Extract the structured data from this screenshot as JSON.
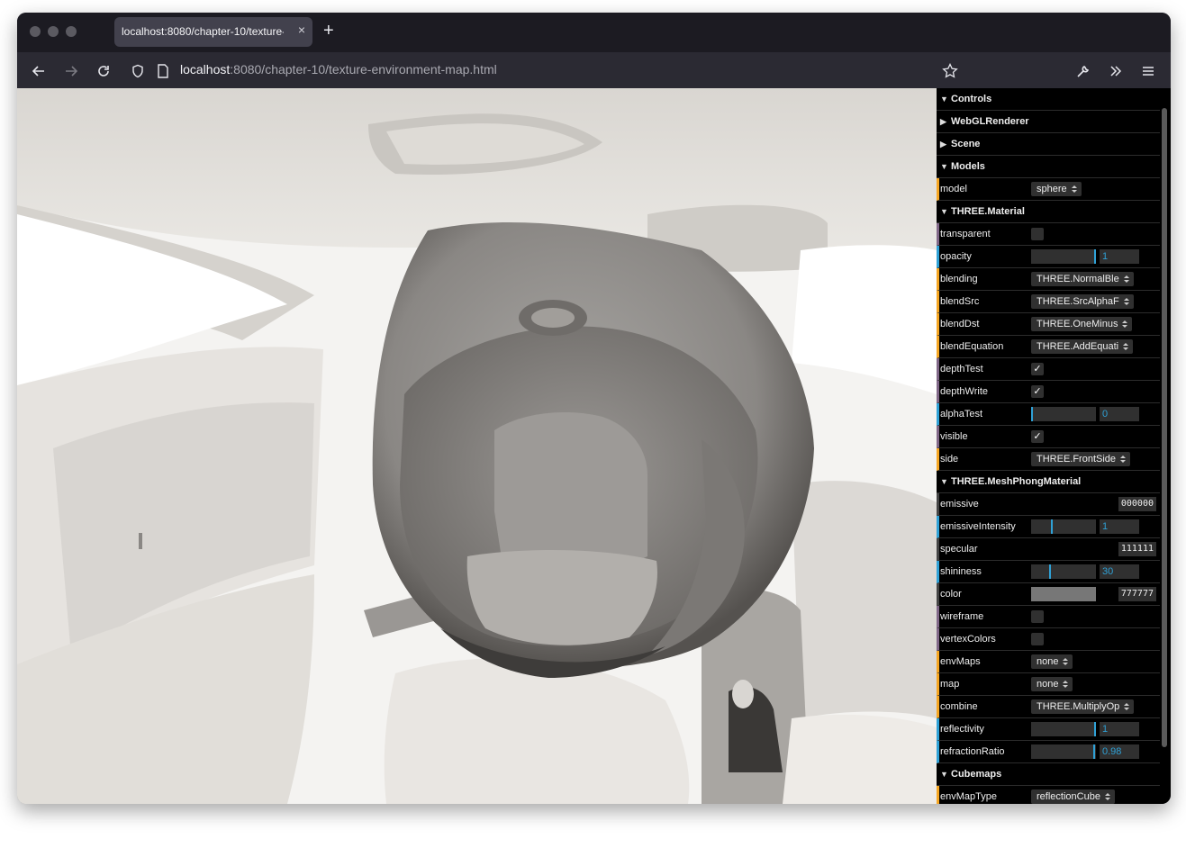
{
  "browser": {
    "tab_title": "localhost:8080/chapter-10/texture-",
    "tab_close": "×",
    "new_tab": "+",
    "url_host": "localhost",
    "url_rest": ":8080/chapter-10/texture-environment-map.html"
  },
  "gui": {
    "controls": "Controls",
    "webgl": "WebGLRenderer",
    "scene": "Scene",
    "models": "Models",
    "model_label": "model",
    "model_value": "sphere",
    "material": "THREE.Material",
    "transparent": "transparent",
    "opacity": "opacity",
    "opacity_value": "1",
    "blending": "blending",
    "blending_value": "THREE.NormalBle",
    "blendSrc": "blendSrc",
    "blendSrc_value": "THREE.SrcAlphaF",
    "blendDst": "blendDst",
    "blendDst_value": "THREE.OneMinus",
    "blendEquation": "blendEquation",
    "blendEquation_value": "THREE.AddEquati",
    "depthTest": "depthTest",
    "depthWrite": "depthWrite",
    "alphaTest": "alphaTest",
    "alphaTest_value": "0",
    "visible": "visible",
    "side": "side",
    "side_value": "THREE.FrontSide",
    "phong": "THREE.MeshPhongMaterial",
    "emissive": "emissive",
    "emissive_value": "000000",
    "emissiveIntensity": "emissiveIntensity",
    "emissiveIntensity_value": "1",
    "specular": "specular",
    "specular_value": "111111",
    "shininess": "shininess",
    "shininess_value": "30",
    "color": "color",
    "color_value": "777777",
    "wireframe": "wireframe",
    "vertexColors": "vertexColors",
    "envMaps": "envMaps",
    "envMaps_value": "none",
    "map": "map",
    "map_value": "none",
    "combine": "combine",
    "combine_value": "THREE.MultiplyOp",
    "reflectivity": "reflectivity",
    "reflectivity_value": "1",
    "refractionRatio": "refractionRatio",
    "refractionRatio_value": "0.98",
    "cubemaps": "Cubemaps",
    "envMapType": "envMapType",
    "envMapType_value": "reflectionCube"
  },
  "colors": {
    "accent_number": "#2fa1d6",
    "accent_boolean": "#806787",
    "accent_select": "#f5a623",
    "material_color": "#777777"
  },
  "slider_levels": {
    "opacity": 1,
    "alphaTest": 0,
    "emissiveIntensity": 0.33,
    "shininess": 0.3,
    "reflectivity": 1,
    "refractionRatio": 0.98
  }
}
